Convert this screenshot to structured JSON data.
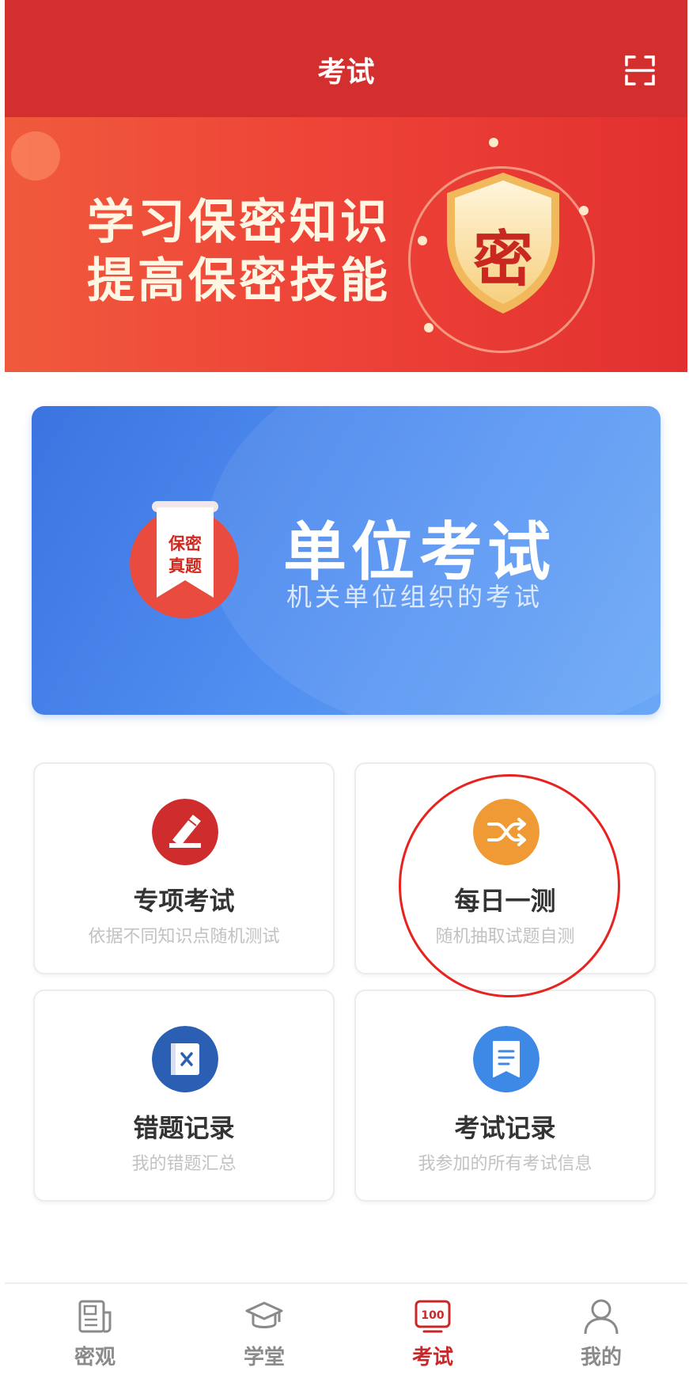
{
  "header": {
    "title": "考试"
  },
  "hero": {
    "line1": "学习保密知识",
    "line2": "提高保密技能",
    "shield_char": "密"
  },
  "exam_banner": {
    "title": "单位考试",
    "subtitle": "机关单位组织的考试",
    "badge_line1": "保密",
    "badge_line2": "真题"
  },
  "cards": [
    {
      "title": "专项考试",
      "subtitle": "依据不同知识点随机测试",
      "icon": "pencil-icon",
      "color": "#cf2d2d"
    },
    {
      "title": "每日一测",
      "subtitle": "随机抽取试题自测",
      "icon": "shuffle-icon",
      "color": "#ef9a34"
    },
    {
      "title": "错题记录",
      "subtitle": "我的错题汇总",
      "icon": "wrong-book-icon",
      "color": "#2a5fb4"
    },
    {
      "title": "考试记录",
      "subtitle": "我参加的所有考试信息",
      "icon": "document-icon",
      "color": "#3f89e6"
    }
  ],
  "nav": {
    "active_index": 2,
    "items": [
      {
        "label": "密观",
        "icon": "news-icon"
      },
      {
        "label": "学堂",
        "icon": "graduation-cap-icon"
      },
      {
        "label": "考试",
        "icon": "score-100-icon"
      },
      {
        "label": "我的",
        "icon": "person-icon"
      }
    ]
  },
  "colors": {
    "header": "#d42f2f",
    "banner_blue": "#4f8df0",
    "active_tab": "#c8282a",
    "annotation": "#e8231f"
  }
}
